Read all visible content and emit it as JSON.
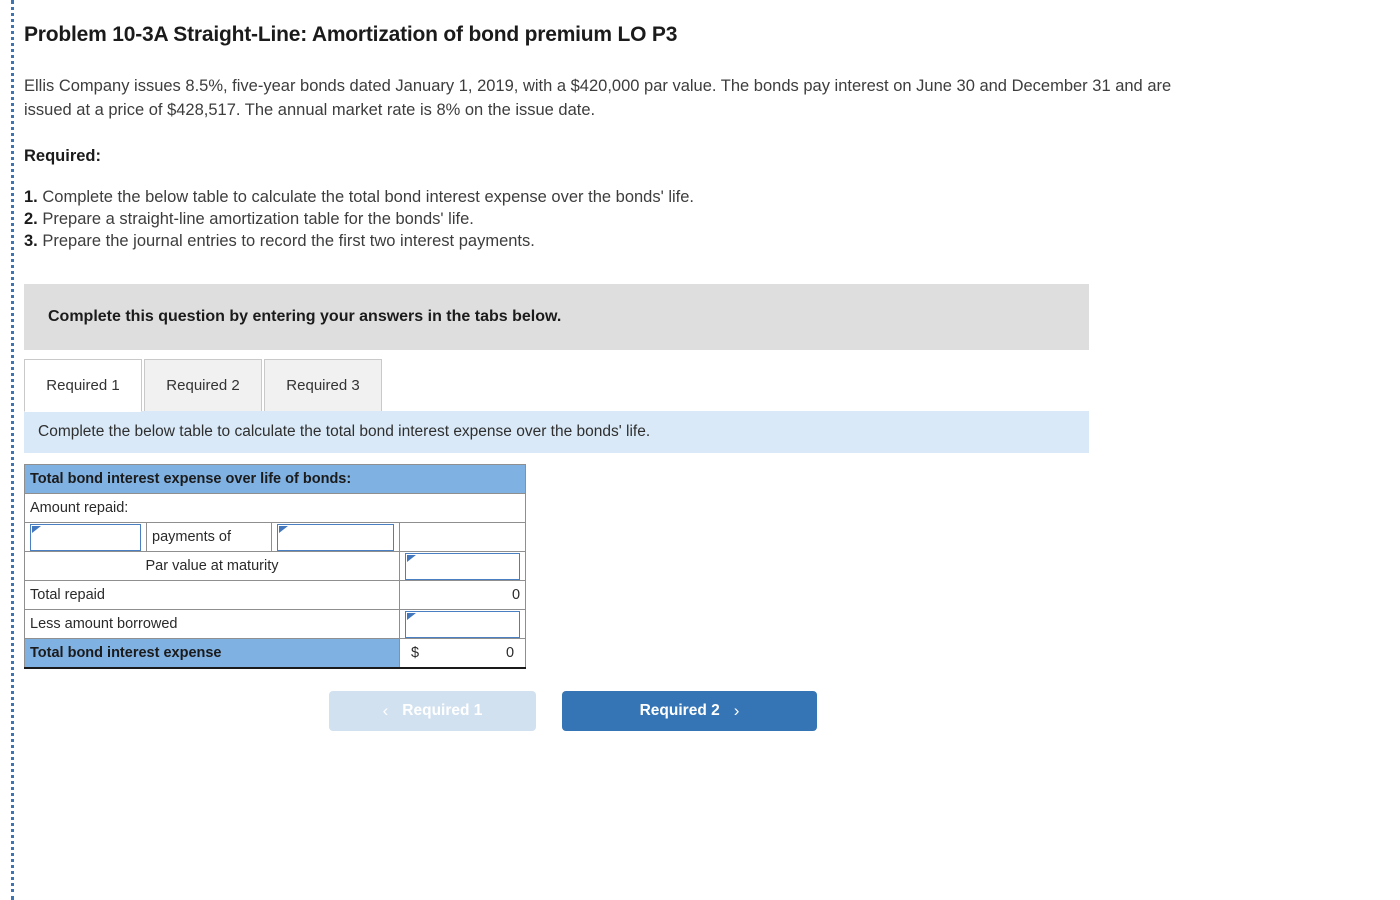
{
  "problem": {
    "title": "Problem 10-3A Straight-Line: Amortization of bond premium LO P3",
    "body": "Ellis Company issues 8.5%, five-year bonds dated January 1, 2019, with a $420,000 par value. The bonds pay interest on June 30 and December 31 and are issued at a price of $428,517. The annual market rate is 8% on the issue date.",
    "required_label": "Required:",
    "requirements": [
      {
        "num": "1.",
        "text": "Complete the below table to calculate the total bond interest expense over the bonds' life."
      },
      {
        "num": "2.",
        "text": "Prepare a straight-line amortization table for the bonds' life."
      },
      {
        "num": "3.",
        "text": "Prepare the journal entries to record the first two interest payments."
      }
    ]
  },
  "banner": {
    "instruction": "Complete this question by entering your answers in the tabs below."
  },
  "tabs": [
    {
      "label": "Required 1",
      "active": true
    },
    {
      "label": "Required 2",
      "active": false
    },
    {
      "label": "Required 3",
      "active": false
    }
  ],
  "tab_instruction": "Complete the below table to calculate the total bond interest expense over the bonds' life.",
  "table": {
    "header": "Total bond interest expense over life of bonds:",
    "row_amount_repaid": "Amount repaid:",
    "row_payments_of": "payments of",
    "row_par_value": "Par value at maturity",
    "row_total_repaid_label": "Total repaid",
    "row_total_repaid_value": "0",
    "row_less_borrowed_label": "Less amount borrowed",
    "row_total_expense_label": "Total bond interest expense",
    "row_total_expense_currency": "$",
    "row_total_expense_value": "0",
    "input_payments_count": "",
    "input_payment_amount": "",
    "input_payments_total": "",
    "input_par_value": "",
    "input_less_borrowed": ""
  },
  "nav": {
    "prev_label": "Required 1",
    "prev_chevron": "chevron-left-icon",
    "prev_glyph": "‹",
    "next_label": "Required 2",
    "next_chevron": "chevron-right-icon",
    "next_glyph": "›"
  },
  "colors": {
    "table_header_blue": "#7fb1e3",
    "banner_gray": "#dededf",
    "banner_light_blue": "#d9e9f7",
    "button_primary": "#3575b5",
    "button_disabled": "#d2e1f0",
    "input_border_blue": "#4a7fc1",
    "left_rule_blue": "#3f74b2"
  }
}
